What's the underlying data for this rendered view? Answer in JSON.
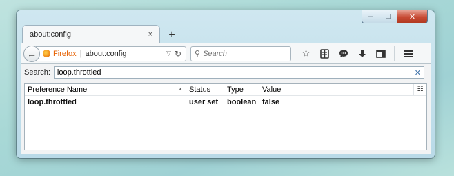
{
  "window": {
    "controls": {
      "minimize": "–",
      "maximize": "□",
      "close": "✕"
    }
  },
  "tab": {
    "title": "about:config",
    "close": "×",
    "new_tab": "+"
  },
  "toolbar": {
    "back": "←",
    "identity_label": "Firefox",
    "url": "about:config",
    "dropdown": "▽",
    "reload": "C",
    "search_placeholder": "Search",
    "icons": [
      "star-icon",
      "reading-list-icon",
      "chat-icon",
      "download-icon",
      "sidebar-icon",
      "menu-icon"
    ]
  },
  "page": {
    "search_label": "Search:",
    "search_value": "loop.throttled",
    "clear": "✕",
    "columns": {
      "name": "Preference Name",
      "status": "Status",
      "type": "Type",
      "value": "Value"
    },
    "rows": [
      {
        "name": "loop.throttled",
        "status": "user set",
        "type": "boolean",
        "value": "false"
      }
    ]
  },
  "colors": {
    "accent": "#e66000",
    "close_button": "#c74a33"
  }
}
